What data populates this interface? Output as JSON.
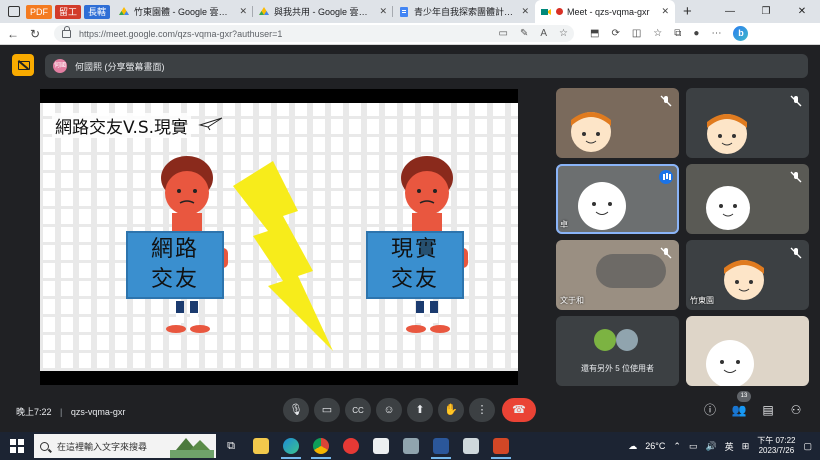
{
  "browser": {
    "pills": [
      {
        "label": "PDF",
        "color": "#f47b20"
      },
      {
        "label": "留工",
        "color": "#d23b2a"
      },
      {
        "label": "長轄",
        "color": "#2f6fd6"
      }
    ],
    "tabs": [
      {
        "label": "竹東園體 - Google 雲端硬碟",
        "close": "✕"
      },
      {
        "label": "與我共用 - Google 雲端硬碟",
        "close": "✕"
      },
      {
        "label": "青少年自我探索團體計畫書_陳...",
        "close": "✕"
      },
      {
        "label": "Meet - qzs-vqma-gxr",
        "close": "✕"
      }
    ],
    "new_tab": "+",
    "window_controls": [
      "—",
      "❐",
      "✕"
    ],
    "url": "https://meet.google.com/qzs-vqma-gxr?authuser=1"
  },
  "meet": {
    "presenter_initials": "何國",
    "presenter_text": "何國熙 (分享螢幕畫面)",
    "slide": {
      "title": "網路交友V.S.現實",
      "left_sign": [
        "網路",
        "交友"
      ],
      "right_sign": [
        "現實",
        "交友"
      ]
    },
    "participants": [
      {
        "name": ""
      },
      {
        "name": ""
      },
      {
        "name": "卓"
      },
      {
        "name": ""
      },
      {
        "name": "文于和"
      },
      {
        "name": "竹東園"
      },
      {
        "name": "還有另外 5 位使用者"
      },
      {
        "name": ""
      }
    ],
    "time": "晚上7:22",
    "meeting_code": "qzs-vqma-gxr",
    "people_count": "13"
  },
  "taskbar": {
    "search_placeholder": "在這裡輸入文字來搜尋",
    "weather": "26°C",
    "ime": "英",
    "time": "下午 07:22",
    "date": "2023/7/26"
  },
  "colors": {
    "meet_bg": "#202124",
    "tile_bg": "#3c4043",
    "end_call": "#ea4335",
    "speaking_outline": "#8ab4f8",
    "presenter_badge": "#f9ab00"
  }
}
